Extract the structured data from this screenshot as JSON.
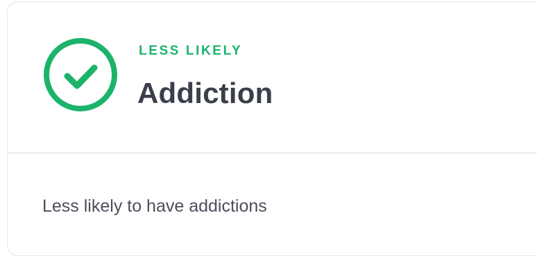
{
  "card": {
    "status_label": "LESS LIKELY",
    "title": "Addiction",
    "description": "Less likely to have addictions",
    "status_icon": "check-circle-icon",
    "accent_color": "#1cb36b"
  }
}
